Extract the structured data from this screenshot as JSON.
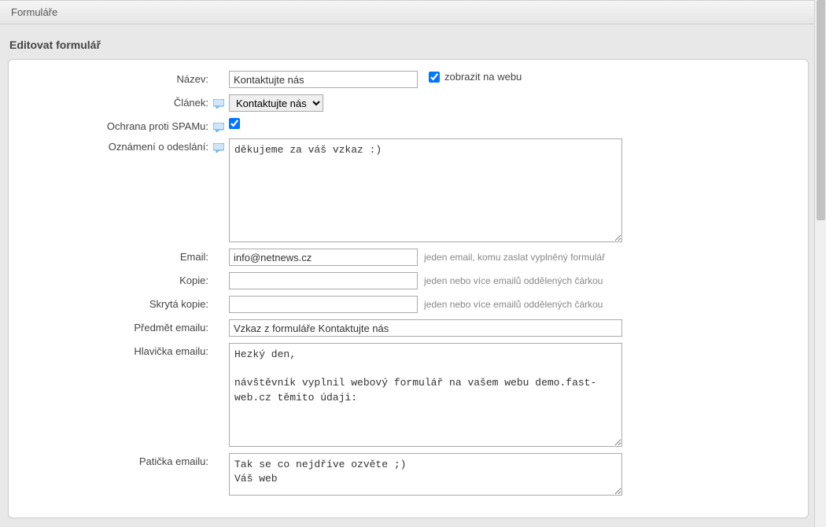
{
  "breadcrumb": "Formuláře",
  "page_title": "Editovat formulář",
  "labels": {
    "name": "Název:",
    "article": "Článek:",
    "spam": "Ochrana proti SPAMu:",
    "notice": "Oznámení o odeslání:",
    "email": "Email:",
    "cc": "Kopie:",
    "bcc": "Skrytá kopie:",
    "subject": "Předmět emailu:",
    "header": "Hlavička emailu:",
    "footer": "Patička emailu:"
  },
  "fields": {
    "name_value": "Kontaktujte nás",
    "show_on_web": "zobrazit na webu",
    "article_selected": "Kontaktujte nás",
    "notice_value": "děkujeme za váš vzkaz :)",
    "email_value": "info@netnews.cz",
    "cc_value": "",
    "bcc_value": "",
    "subject_value": "Vzkaz z formuláře Kontaktujte nás",
    "header_value": "Hezký den,\n\nnávštěvník vyplnil webový formulář na vašem webu demo.fast-web.cz těmito údaji:",
    "footer_value": "Tak se co nejdříve ozvěte ;)\nVáš web"
  },
  "hints": {
    "email": "jeden email, komu zaslat vyplněný formulář",
    "cc": "jeden nebo více emailů oddělených čárkou",
    "bcc": "jeden nebo více emailů oddělených čárkou"
  }
}
